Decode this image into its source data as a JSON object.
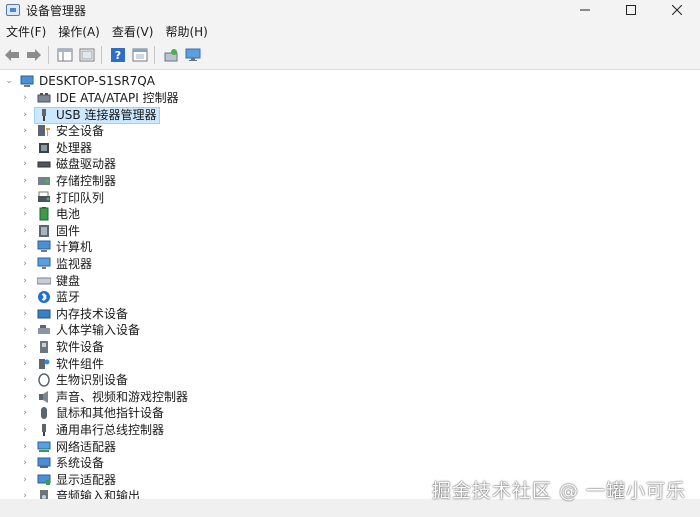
{
  "window": {
    "title": "设备管理器",
    "controls": {
      "minimize": "minimize",
      "maximize": "maximize",
      "close": "close"
    }
  },
  "menu": [
    "文件(F)",
    "操作(A)",
    "查看(V)",
    "帮助(H)"
  ],
  "toolbar": [
    "back-arrow-icon",
    "forward-arrow-icon",
    "properties-panel-icon",
    "device-list-icon",
    "help-icon",
    "update-driver-icon",
    "scan-hardware-icon",
    "monitor-view-icon"
  ],
  "tree": {
    "root": "DESKTOP-S1SR7QA",
    "items": [
      {
        "label": "IDE ATA/ATAPI 控制器",
        "icon": "ide-controller-icon"
      },
      {
        "label": "USB 连接器管理器",
        "icon": "usb-connector-icon",
        "selected": true
      },
      {
        "label": "安全设备",
        "icon": "security-device-icon"
      },
      {
        "label": "处理器",
        "icon": "processor-icon"
      },
      {
        "label": "磁盘驱动器",
        "icon": "disk-drive-icon"
      },
      {
        "label": "存储控制器",
        "icon": "storage-controller-icon"
      },
      {
        "label": "打印队列",
        "icon": "print-queue-icon"
      },
      {
        "label": "电池",
        "icon": "battery-icon"
      },
      {
        "label": "固件",
        "icon": "firmware-icon"
      },
      {
        "label": "计算机",
        "icon": "computer-icon"
      },
      {
        "label": "监视器",
        "icon": "monitor-icon"
      },
      {
        "label": "键盘",
        "icon": "keyboard-icon"
      },
      {
        "label": "蓝牙",
        "icon": "bluetooth-icon"
      },
      {
        "label": "内存技术设备",
        "icon": "memory-device-icon"
      },
      {
        "label": "人体学输入设备",
        "icon": "hid-icon"
      },
      {
        "label": "软件设备",
        "icon": "software-device-icon"
      },
      {
        "label": "软件组件",
        "icon": "software-component-icon"
      },
      {
        "label": "生物识别设备",
        "icon": "biometric-icon"
      },
      {
        "label": "声音、视频和游戏控制器",
        "icon": "sound-video-icon"
      },
      {
        "label": "鼠标和其他指针设备",
        "icon": "mouse-icon"
      },
      {
        "label": "通用串行总线控制器",
        "icon": "usb-controller-icon"
      },
      {
        "label": "网络适配器",
        "icon": "network-adapter-icon"
      },
      {
        "label": "系统设备",
        "icon": "system-device-icon"
      },
      {
        "label": "显示适配器",
        "icon": "display-adapter-icon"
      },
      {
        "label": "音频输入和输出",
        "icon": "audio-io-icon"
      }
    ]
  },
  "watermark": "掘金技术社区 @ 一罐小可乐",
  "colors": {
    "selection_bg": "#cce8ff",
    "selection_border": "#99d1ff",
    "window_bg": "#f3f3f3"
  }
}
